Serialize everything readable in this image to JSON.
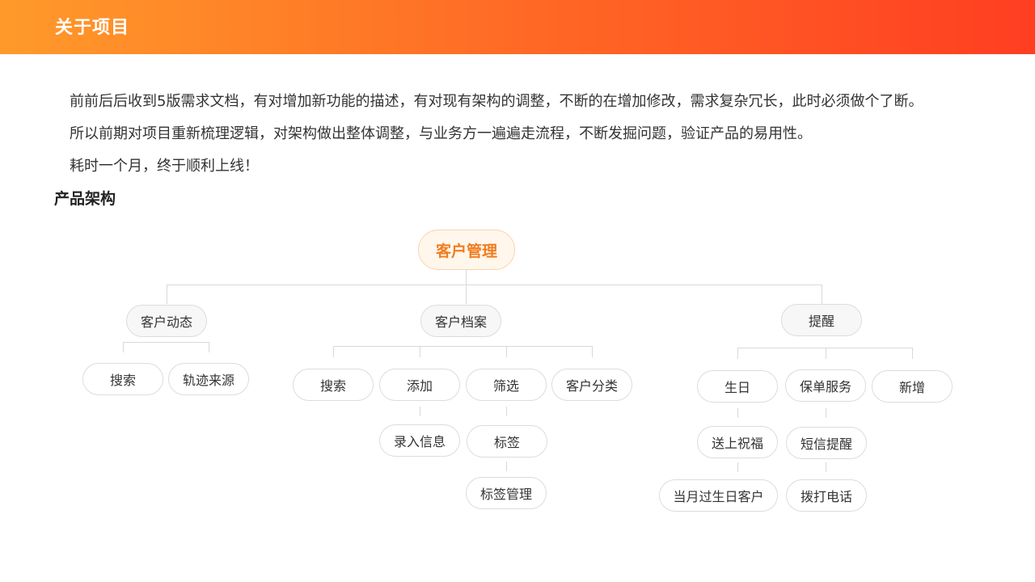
{
  "header": {
    "title": "关于项目"
  },
  "intro": {
    "lines": [
      "前前后后收到5版需求文档，有对增加新功能的描述，有对现有架构的调整，不断的在增加修改，需求复杂冗长，此时必须做个了断。",
      "所以前期对项目重新梳理逻辑，对架构做出整体调整，与业务方一遍遍走流程，不断发掘问题，验证产品的易用性。",
      "耗时一个月，终于顺利上线！"
    ]
  },
  "section": {
    "title": "产品架构"
  },
  "diagram": {
    "root": "客户管理",
    "branches": [
      {
        "label": "客户动态",
        "children": [
          {
            "label": "搜索"
          },
          {
            "label": "轨迹来源"
          }
        ]
      },
      {
        "label": "客户档案",
        "children": [
          {
            "label": "搜索"
          },
          {
            "label": "添加",
            "children": [
              {
                "label": "录入信息"
              }
            ]
          },
          {
            "label": "筛选",
            "children": [
              {
                "label": "标签",
                "children": [
                  {
                    "label": "标签管理"
                  }
                ]
              }
            ]
          },
          {
            "label": "客户分类"
          }
        ]
      },
      {
        "label": "提醒",
        "children": [
          {
            "label": "生日",
            "children": [
              {
                "label": "送上祝福",
                "children": [
                  {
                    "label": "当月过生日客户"
                  }
                ]
              }
            ]
          },
          {
            "label": "保单服务",
            "children": [
              {
                "label": "短信提醒",
                "children": [
                  {
                    "label": "拨打电话"
                  }
                ]
              }
            ]
          },
          {
            "label": "新增"
          }
        ]
      }
    ]
  }
}
